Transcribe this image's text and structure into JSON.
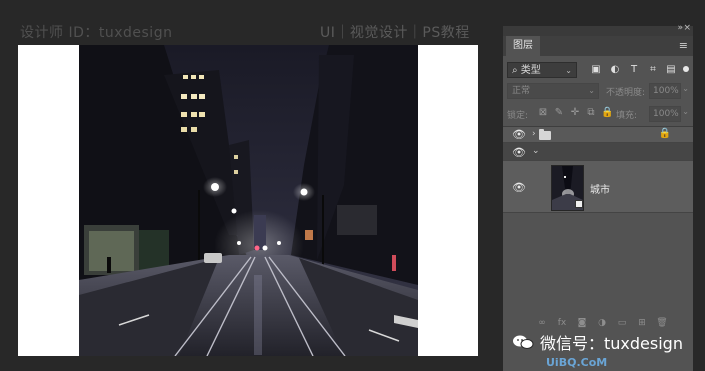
{
  "header": {
    "designer_id": "设计师 ID：tuxdesign",
    "tagline": "UI｜视觉设计｜PS教程"
  },
  "layers_panel": {
    "tab_label": "图层",
    "filter_kind": "类型",
    "blend_mode": "正常",
    "opacity_label": "不透明度:",
    "opacity_value": "100%",
    "lock_label": "锁定:",
    "fill_label": "填充:",
    "fill_value": "100%",
    "layers": [
      {
        "type": "group",
        "visible": true,
        "locked": true
      },
      {
        "type": "group-expanded",
        "visible": true
      },
      {
        "type": "smart-object",
        "visible": true,
        "name": "城市"
      }
    ]
  },
  "watermark": {
    "text": "微信号：tuxdesign",
    "logo": "UiBQ.CoM"
  },
  "icons": {
    "filter": [
      "image-filter-icon",
      "adjustment-filter-icon",
      "type-filter-icon",
      "shape-filter-icon",
      "smart-object-filter-icon"
    ],
    "lock": [
      "lock-pixels-icon",
      "lock-image-icon",
      "lock-position-icon",
      "lock-artboard-icon",
      "lock-all-icon"
    ],
    "bottom": [
      "link-icon",
      "fx-icon",
      "mask-icon",
      "adjustment-icon",
      "folder-icon",
      "new-layer-icon",
      "trash-icon"
    ]
  }
}
